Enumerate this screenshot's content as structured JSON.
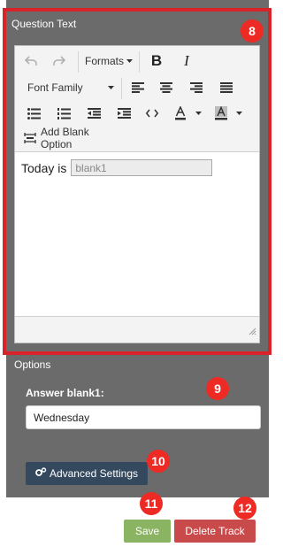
{
  "question": {
    "label": "Question Text",
    "toolbar": {
      "undo_icon": "undo-icon",
      "redo_icon": "redo-icon",
      "formats_label": "Formats",
      "bold_label": "B",
      "italic_label": "I",
      "font_family_label": "Font Family",
      "add_blank_label": "Add Blank Option"
    },
    "content": {
      "text": "Today is",
      "blank_value": "blank1"
    }
  },
  "options": {
    "label": "Options",
    "answer_label": "Answer blank1:",
    "answer_value": "Wednesday",
    "advanced_label": "Advanced Settings"
  },
  "actions": {
    "save_label": "Save",
    "delete_label": "Delete Track"
  },
  "callouts": [
    "8",
    "9",
    "10",
    "11",
    "12"
  ],
  "colors": {
    "panel": "#6b6b6b",
    "highlight": "#d8232a",
    "badge": "#ee2a24",
    "advanced_button": "#34495e",
    "save_button": "#8ab461",
    "delete_button": "#c94a4a"
  }
}
